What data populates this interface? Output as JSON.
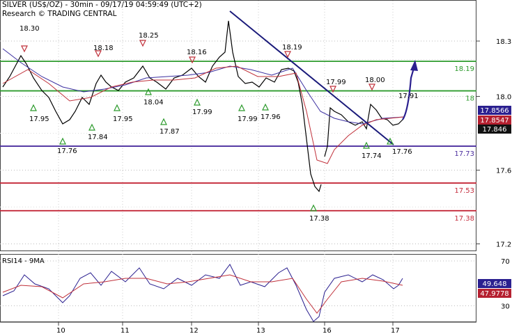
{
  "header": {
    "title": "SILVER (US$/OZ) - 30min - 09/17/19 04:59:49 (UTC+2)",
    "source": "Research © TRADING CENTRAL"
  },
  "chart_data": [
    {
      "type": "line",
      "instrument": "SILVER (US$/OZ)",
      "timeframe": "30min",
      "ylim": [
        17.12,
        18.45
      ],
      "y_ticks": [
        17.2,
        17.6,
        18.0,
        18.3
      ],
      "y_tick_labels": [
        "17.2",
        "17.6",
        "18.0",
        "18.3"
      ],
      "x_tick_labels": [
        "10",
        "11",
        "12",
        "13",
        "16",
        "17"
      ],
      "grid": true,
      "series": [
        {
          "x": [
            "10",
            "11",
            "12",
            "13",
            "16",
            "17"
          ],
          "values": [
            17.85,
            17.98,
            18.1,
            18.05,
            17.5,
            17.85
          ]
        }
      ],
      "levels": [
        {
          "value": 18.19,
          "label": "18.19",
          "color": "#2e9b2e"
        },
        {
          "value": 18.03,
          "label": "18",
          "color": "#2e9b2e"
        },
        {
          "value": 17.73,
          "label": "17.73",
          "color": "#4b2e9e"
        },
        {
          "value": 17.53,
          "label": "17.53",
          "color": "#c42a3a"
        },
        {
          "value": 17.38,
          "label": "17.38",
          "color": "#c42a3a"
        }
      ],
      "pivots_high": [
        "18.30",
        "18.18",
        "18.25",
        "18.16",
        "18.19",
        "17.99",
        "18.00"
      ],
      "pivots_low": [
        "17.95",
        "17.76",
        "17.84",
        "17.95",
        "18.04",
        "17.87",
        "17.99",
        "17.99",
        "17.96",
        "17.38",
        "17.74",
        "17.76"
      ],
      "extra_labels": [
        "17.91"
      ],
      "price_tags": [
        {
          "label": "17.8566",
          "color": "#2a1f8f"
        },
        {
          "label": "17.8547",
          "color": "#b52030"
        },
        {
          "label": "17.846",
          "color": "#111111"
        }
      ],
      "trendline_color": "#1a1a7a",
      "forecast_arrow_color": "#2a1f8f"
    },
    {
      "type": "line",
      "title": "RSI14 - 9MA",
      "ylim": [
        10,
        90
      ],
      "y_tick_labels": [
        "70",
        "30"
      ],
      "series": [
        {
          "name": "RSI14",
          "values": [
            49.648
          ],
          "color": "#2a1f8f"
        },
        {
          "name": "9MA",
          "values": [
            47.9778
          ],
          "color": "#b52030"
        }
      ],
      "price_tags": [
        {
          "label": "49.648",
          "color": "#2a1f8f"
        },
        {
          "label": "47.9778",
          "color": "#b52030"
        }
      ]
    }
  ]
}
